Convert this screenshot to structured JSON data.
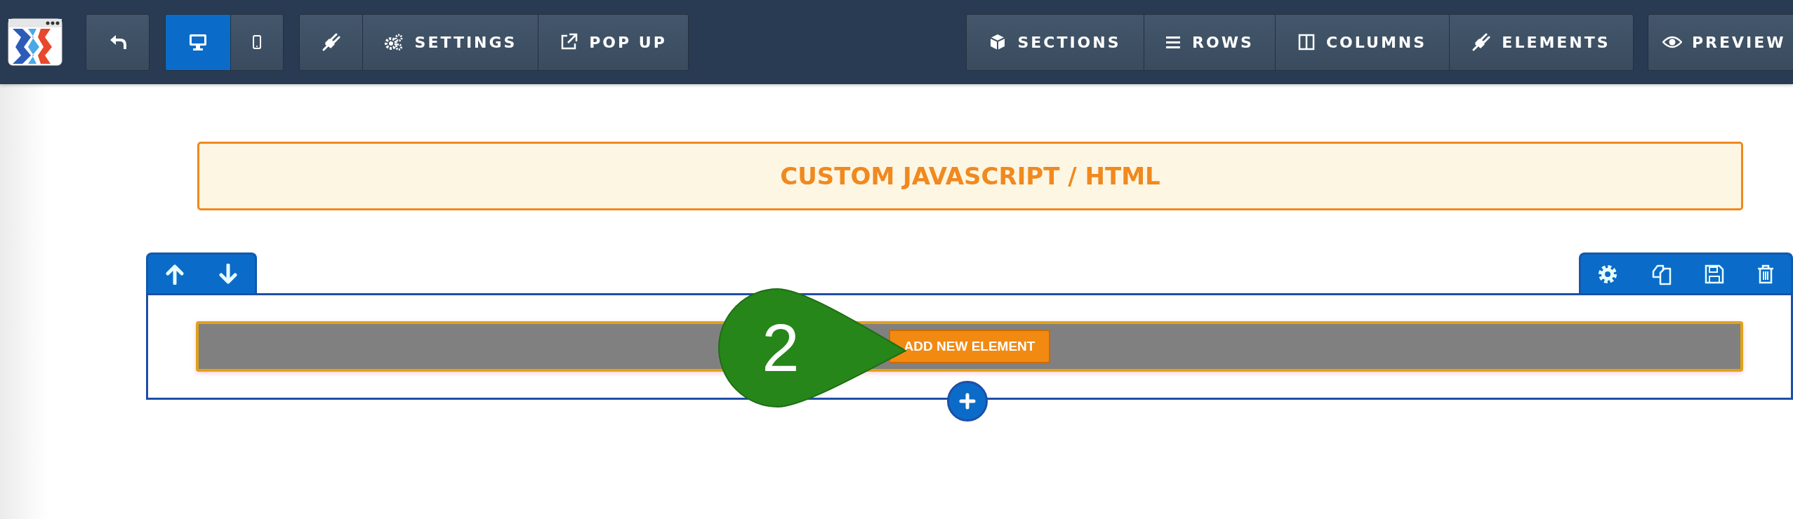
{
  "toolbar": {
    "device_toggle": [
      {
        "kind": "desktop",
        "selected": true
      },
      {
        "kind": "mobile",
        "selected": false
      }
    ],
    "left_buttons": [
      {
        "kind": "plugin"
      },
      {
        "kind": "settings",
        "label": "SETTINGS"
      },
      {
        "kind": "popup",
        "label": "POP UP"
      }
    ],
    "right_buttons": [
      {
        "kind": "sections",
        "label": "SECTIONS"
      },
      {
        "kind": "rows",
        "label": "ROWS"
      },
      {
        "kind": "columns",
        "label": "COLUMNS"
      },
      {
        "kind": "elements",
        "label": "ELEMENTS"
      }
    ],
    "preview": {
      "label": "PREVIEW"
    }
  },
  "banner": {
    "title": "CUSTOM JAVASCRIPT / HTML"
  },
  "row": {
    "left_tools": [
      {
        "kind": "up"
      },
      {
        "kind": "down"
      }
    ],
    "right_tools": [
      {
        "kind": "settings"
      },
      {
        "kind": "copy"
      },
      {
        "kind": "save"
      },
      {
        "kind": "delete"
      }
    ],
    "callout": "2",
    "button": "ADD NEW ELEMENT"
  }
}
